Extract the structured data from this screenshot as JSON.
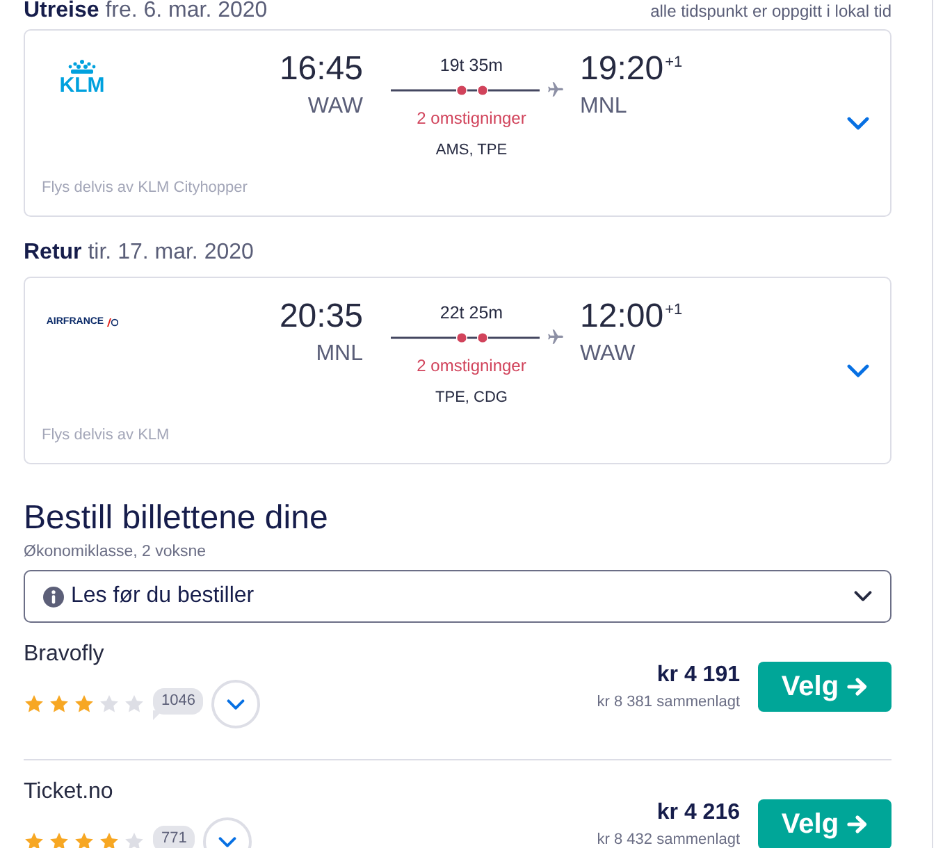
{
  "outbound": {
    "heading": "**Utreise** fre. 6. mar. 2020",
    "note": "alle tidspunkt er oppgitt i lokal tid",
    "flight": {
      "logo": {
        "kind": "klm",
        "text": "KLM"
      },
      "departure": {
        "time": "16:45",
        "airport": "WAW"
      },
      "duration": "19t 35m",
      "stops": "2 omstigninger",
      "via": "AMS, TPE",
      "arrival": {
        "time": "19:20",
        "day_offset": "+1",
        "airport": "MNL"
      },
      "operated_by": "Flys delvis av KLM Cityhopper",
      "expanded": false
    }
  },
  "return": {
    "heading": "**Retur** tir. 17. mar. 2020",
    "flight": {
      "logo": {
        "kind": "airfrance",
        "text": "AIRFRANCE"
      },
      "departure": {
        "time": "20:35",
        "airport": "MNL"
      },
      "duration": "22t 25m",
      "stops": "2 omstigninger",
      "via": "TPE, CDG",
      "arrival": {
        "time": "12:00",
        "day_offset": "+1",
        "airport": "WAW"
      },
      "operated_by": "Flys delvis av KLM",
      "expanded": false
    }
  },
  "booking": {
    "title": "Bestill billettene dine",
    "subtitle": "Økonomiklasse, 2 voksne",
    "notice": {
      "label": "Les før du bestiller",
      "expanded": false
    },
    "offers": [
      {
        "provider": "Bravofly",
        "stars": 3,
        "reviews": "1046",
        "expanded": false,
        "price": "kr 4 191",
        "total": "kr 8 381 sammenlagt",
        "button": "Velg"
      },
      {
        "provider": "Ticket.no",
        "stars": 4,
        "reviews": "771",
        "expanded": false,
        "price": "kr 4 216",
        "total": "kr 8 432 sammenlagt",
        "button": "Velg"
      }
    ]
  }
}
